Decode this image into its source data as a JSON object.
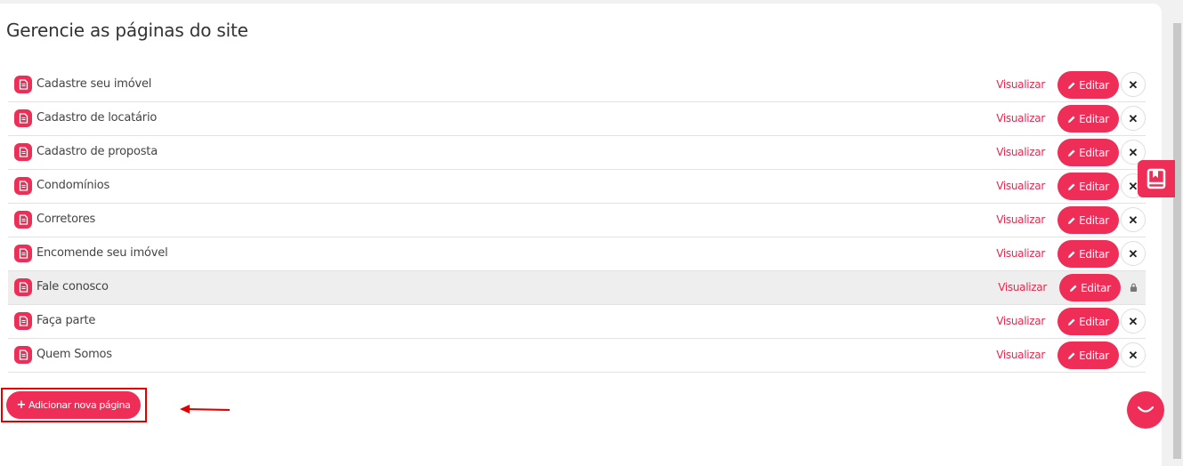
{
  "page": {
    "title": "Gerencie as páginas do site"
  },
  "pages": [
    {
      "label": "Cadastre seu imóvel",
      "view_label": "Visualizar",
      "edit_label": "Editar",
      "action": "delete"
    },
    {
      "label": "Cadastro de locatário",
      "view_label": "Visualizar",
      "edit_label": "Editar",
      "action": "delete"
    },
    {
      "label": "Cadastro de proposta",
      "view_label": "Visualizar",
      "edit_label": "Editar",
      "action": "delete"
    },
    {
      "label": "Condomínios",
      "view_label": "Visualizar",
      "edit_label": "Editar",
      "action": "delete"
    },
    {
      "label": "Corretores",
      "view_label": "Visualizar",
      "edit_label": "Editar",
      "action": "delete"
    },
    {
      "label": "Encomende seu imóvel",
      "view_label": "Visualizar",
      "edit_label": "Editar",
      "action": "delete"
    },
    {
      "label": "Fale conosco",
      "view_label": "Visualizar",
      "edit_label": "Editar",
      "action": "locked"
    },
    {
      "label": "Faça parte",
      "view_label": "Visualizar",
      "edit_label": "Editar",
      "action": "delete"
    },
    {
      "label": "Quem Somos",
      "view_label": "Visualizar",
      "edit_label": "Editar",
      "action": "delete"
    }
  ],
  "add_page": {
    "label": "Adicionar nova página",
    "icon": "plus-icon"
  },
  "icons": {
    "row": "document-icon",
    "edit": "pencil-icon",
    "delete": "close-icon",
    "locked": "lock-icon",
    "side_tab": "bookmark-icon",
    "chat": "chat-icon"
  },
  "colors": {
    "accent": "#ee2e57",
    "link": "#e8284f",
    "annotation": "#e00000",
    "locked_row_bg": "#eeeeee"
  }
}
